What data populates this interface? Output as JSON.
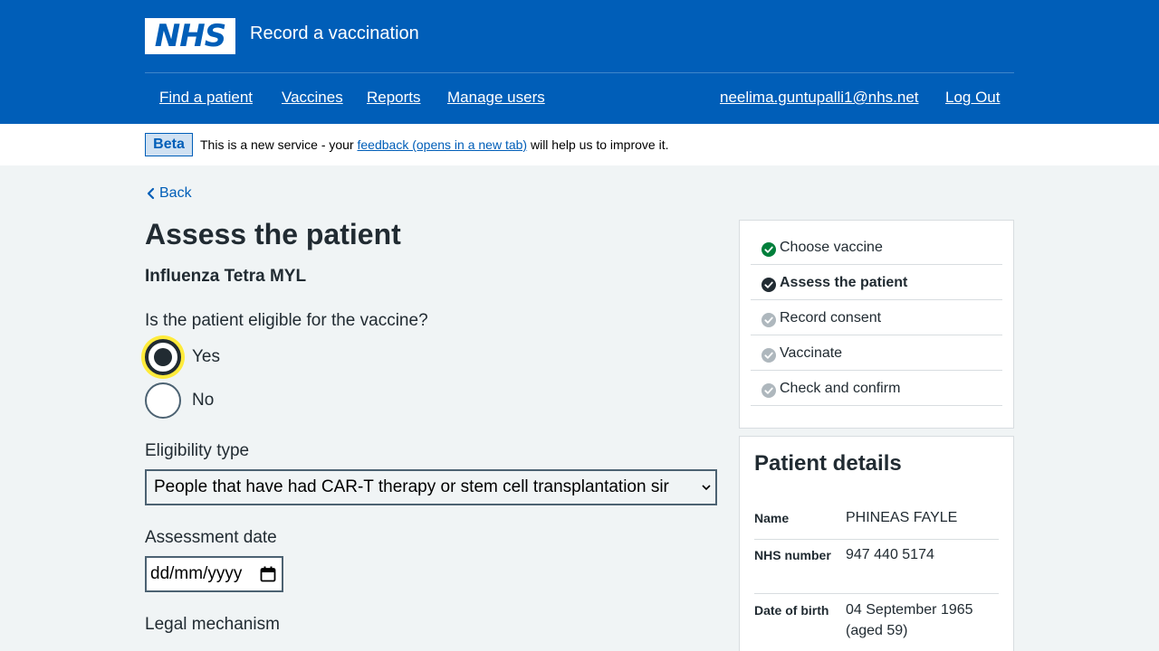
{
  "header": {
    "logo_text": "NHS",
    "service_name": "Record a vaccination",
    "nav": {
      "find_patient": "Find a patient",
      "vaccines": "Vaccines",
      "reports": "Reports",
      "manage_users": "Manage users",
      "user_email": "neelima.guntupalli1@nhs.net",
      "log_out": "Log Out"
    }
  },
  "beta": {
    "tag": "Beta",
    "text_before": "This is a new service - your ",
    "link": "feedback (opens in a new tab)",
    "text_after": " will help us to improve it."
  },
  "back": "Back",
  "page_title": "Assess the patient",
  "vaccine_name": "Influenza Tetra MYL",
  "eligibility_question": {
    "label": "Is the patient eligible for the vaccine?",
    "options": [
      "Yes",
      "No"
    ],
    "selected": "Yes"
  },
  "eligibility_type": {
    "label": "Eligibility type",
    "value": "People that have had CAR-T therapy or stem cell transplantation sir"
  },
  "assessment_date": {
    "label": "Assessment date",
    "placeholder": "dd/mm/yyyy"
  },
  "legal_mechanism": {
    "label": "Legal mechanism"
  },
  "task_list": [
    {
      "label": "Choose vaccine",
      "status": "complete"
    },
    {
      "label": "Assess the patient",
      "status": "current"
    },
    {
      "label": "Record consent",
      "status": "pending"
    },
    {
      "label": "Vaccinate",
      "status": "pending"
    },
    {
      "label": "Check and confirm",
      "status": "pending"
    }
  ],
  "patient_details": {
    "title": "Patient details",
    "rows": [
      {
        "key": "Name",
        "value": "PHINEAS FAYLE"
      },
      {
        "key": "NHS number",
        "value": "947 440 5174"
      },
      {
        "key": "Date of birth",
        "value": "04 September 1965 (aged 59)"
      }
    ]
  },
  "colors": {
    "nhs_blue": "#005eb8",
    "complete_green": "#007f3b",
    "current_dark": "#212b32",
    "pending_grey": "#aeb7bd",
    "focus_yellow": "#ffeb3b"
  }
}
